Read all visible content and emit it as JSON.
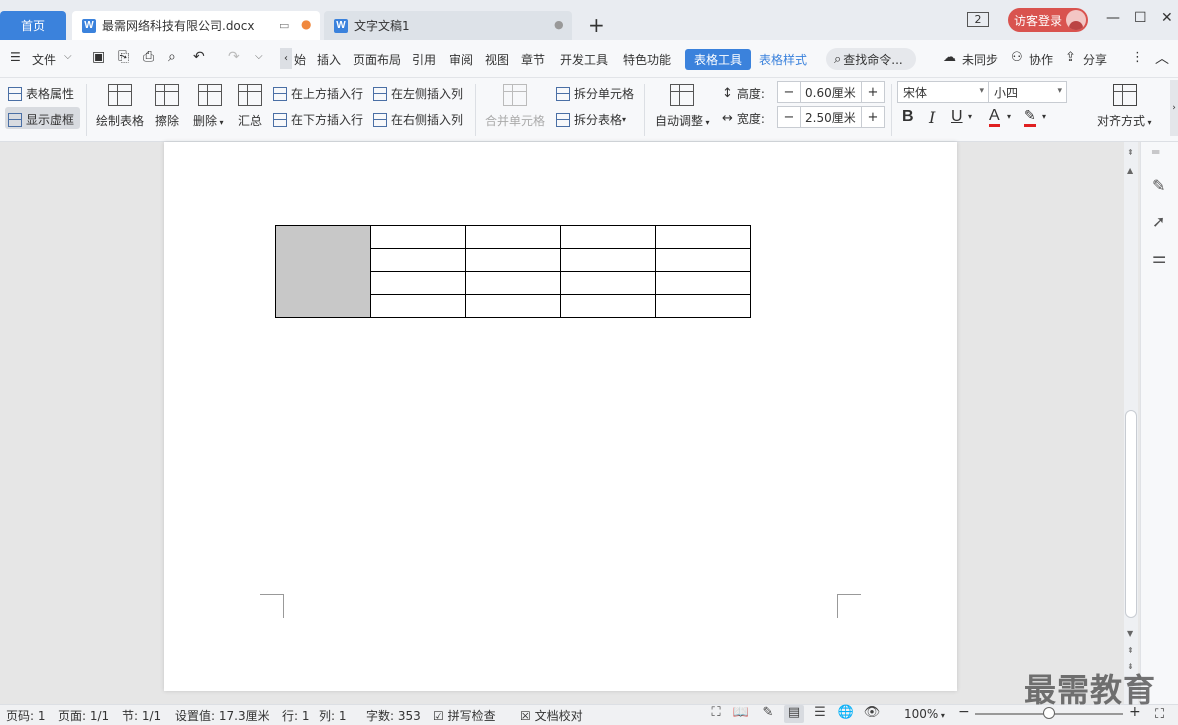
{
  "titlebar": {
    "home_tab": "首页",
    "tabs": [
      {
        "label": "最需网络科技有限公司.docx",
        "active": true
      },
      {
        "label": "文字文稿1",
        "active": false
      }
    ],
    "new_tab": "+",
    "window_count": "2",
    "login_label": "访客登录",
    "controls": {
      "minimize": "—",
      "maximize": "☐",
      "close": "✕"
    }
  },
  "menubar": {
    "file": "文件",
    "items": [
      "始",
      "插入",
      "页面布局",
      "引用",
      "审阅",
      "视图",
      "章节",
      "开发工具",
      "特色功能"
    ],
    "table_tools": "表格工具",
    "table_style": "表格样式",
    "search": "查找命令...",
    "sync": "未同步",
    "collab": "协作",
    "share": "分享"
  },
  "ribbon": {
    "table_props": "表格属性",
    "show_grid": "显示虚框",
    "draw_table": "绘制表格",
    "erase": "擦除",
    "delete": "删除",
    "summary": "汇总",
    "insert_above": "在上方插入行",
    "insert_below": "在下方插入行",
    "insert_left": "在左侧插入列",
    "insert_right": "在右侧插入列",
    "merge_cells": "合并单元格",
    "split_cells": "拆分单元格",
    "split_table": "拆分表格",
    "auto_fit": "自动调整",
    "height_label": "高度:",
    "height_value": "0.60厘米",
    "width_label": "宽度:",
    "width_value": "2.50厘米",
    "font_name": "宋体",
    "font_size": "小四",
    "bold": "B",
    "italic": "I",
    "underline": "U",
    "font_color": "A",
    "align": "对齐方式"
  },
  "document": {
    "table_rows": 4,
    "table_cols": 5
  },
  "statusbar": {
    "page_code": "页码: 1",
    "pages": "页面: 1/1",
    "section": "节: 1/1",
    "setting": "设置值: 17.3厘米",
    "row": "行: 1",
    "col": "列: 1",
    "word_count": "字数: 353",
    "spell_check": "拼写检查",
    "proofread": "文档校对",
    "zoom": "100%",
    "zoom_fraction": 0.5
  },
  "watermark": "最需教育",
  "colors": {
    "accent": "#3b82dc",
    "login": "#d9534f",
    "merged_cell": "#c8c8c8"
  }
}
